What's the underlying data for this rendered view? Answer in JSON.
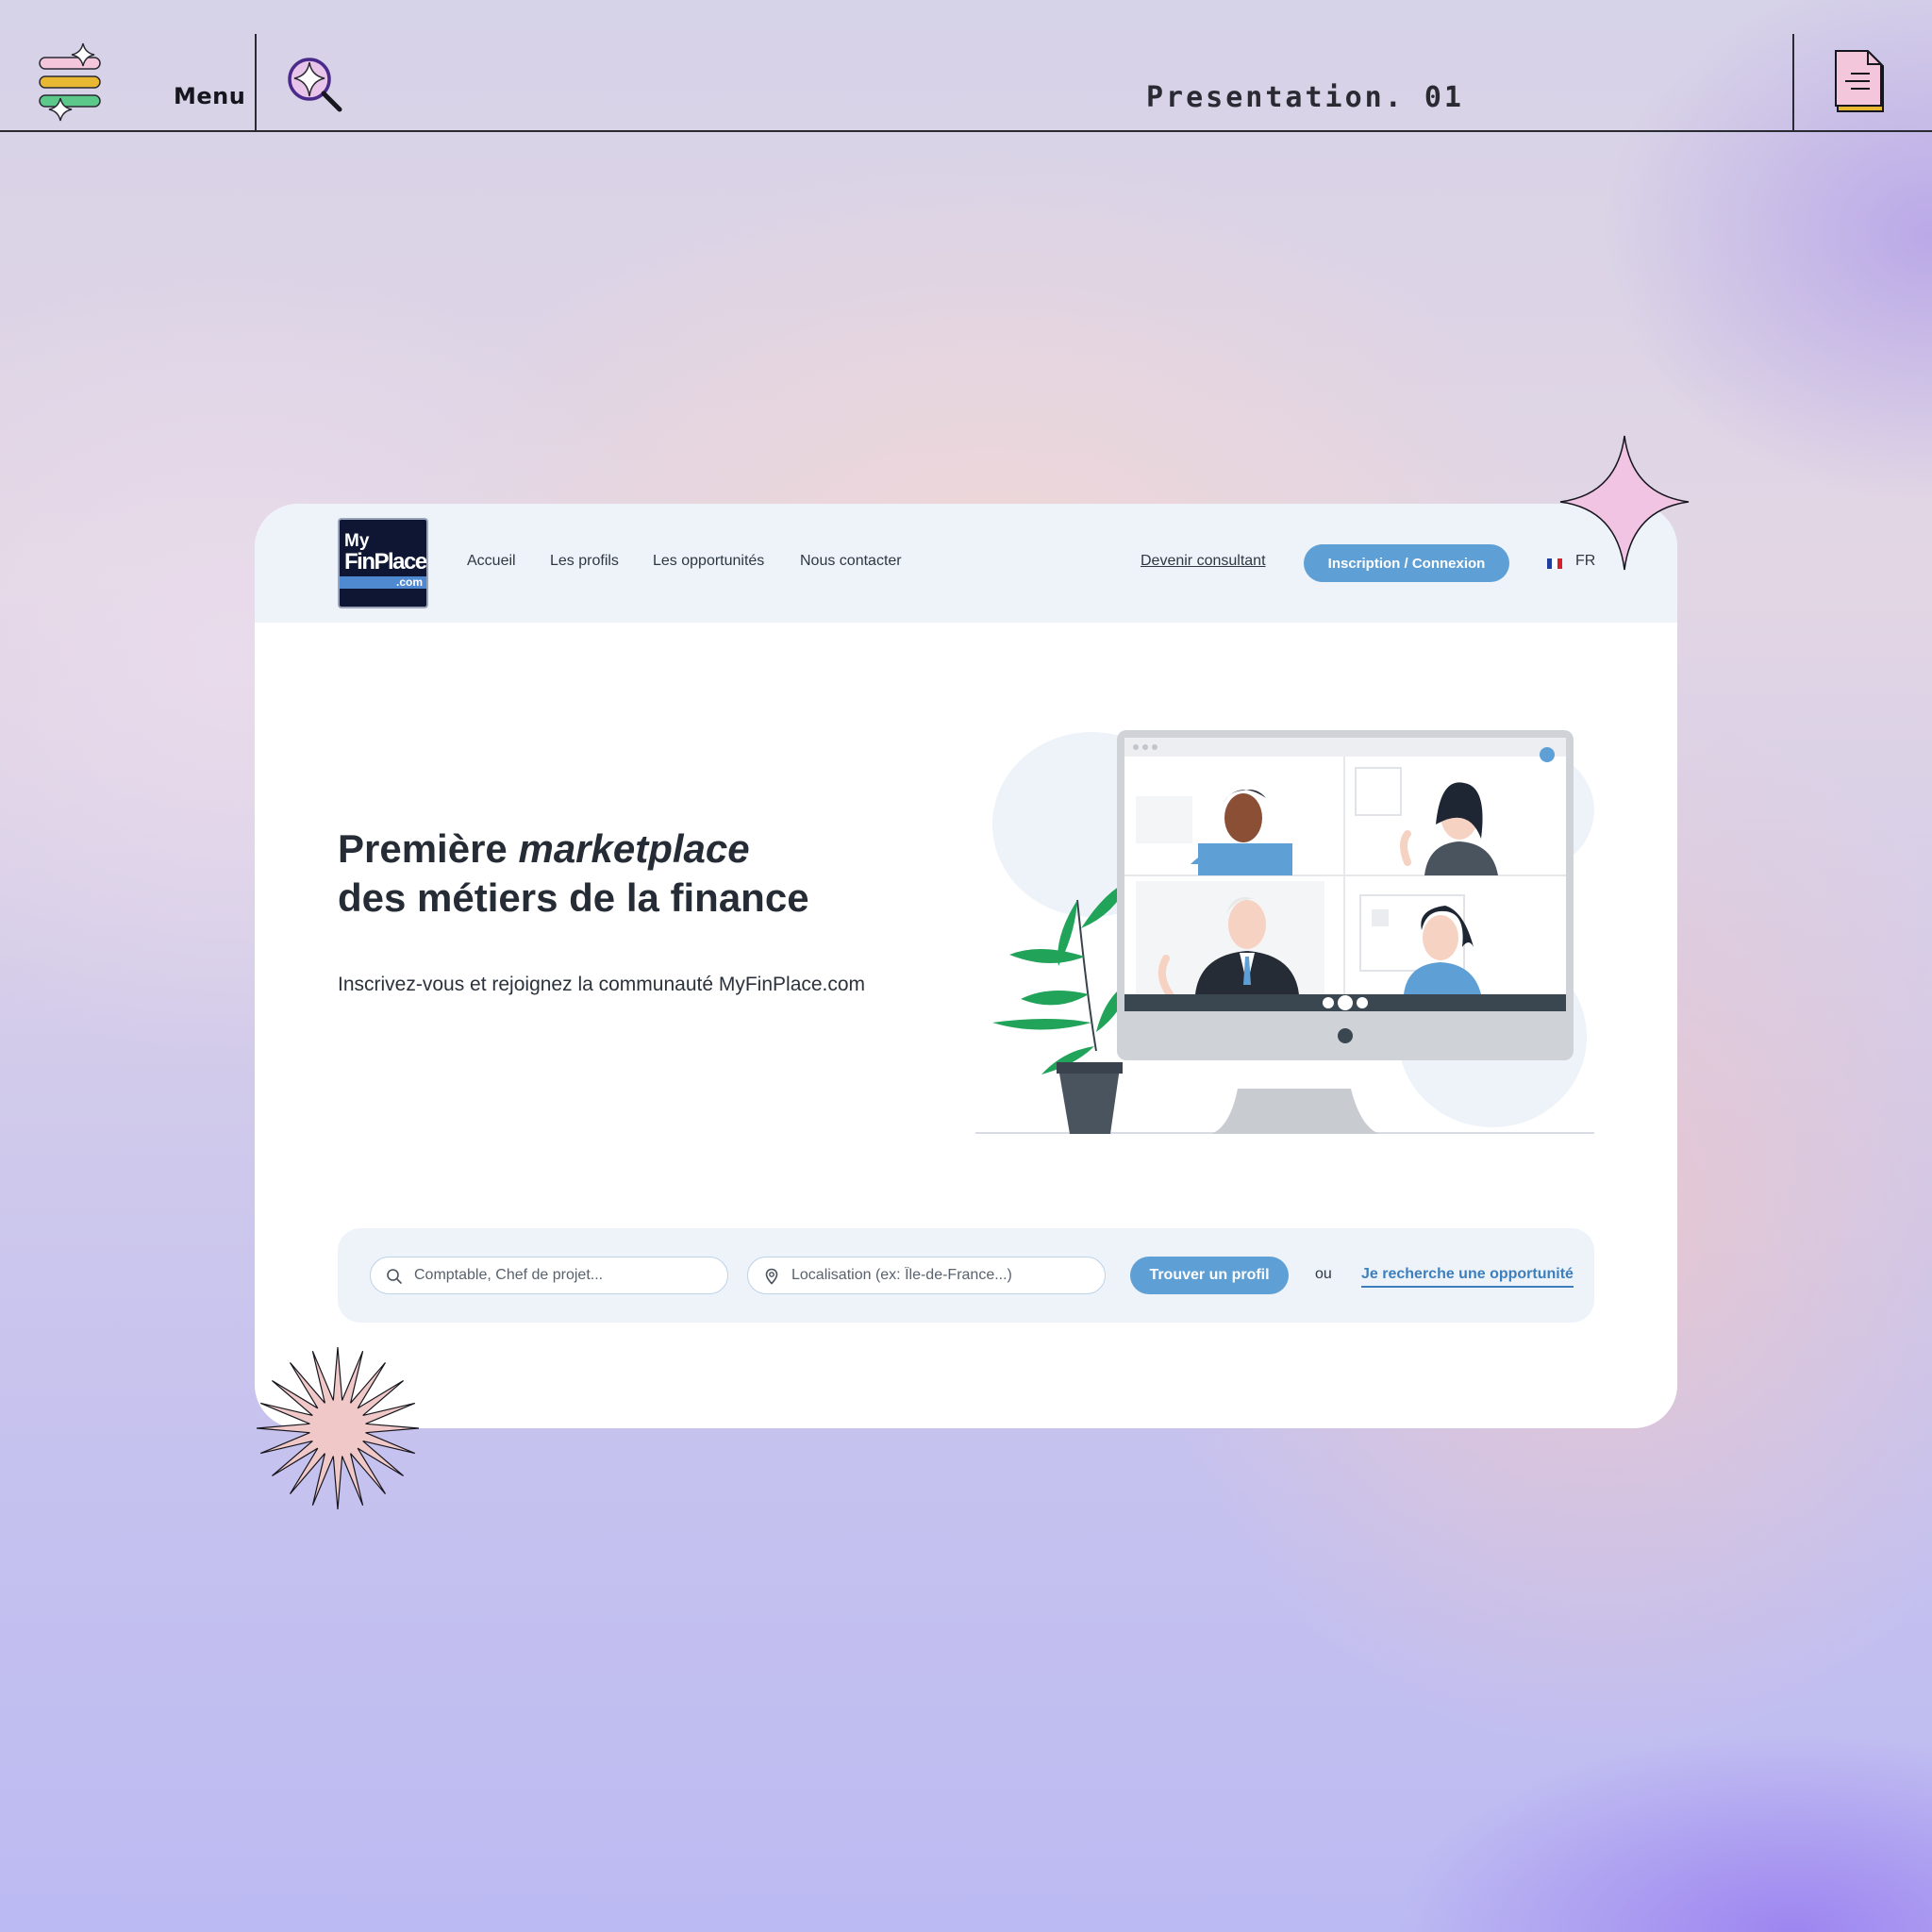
{
  "topbar": {
    "menu_label": "Menu",
    "presentation_title": "Presentation. 01"
  },
  "site": {
    "logo": {
      "line1": "My",
      "line2": "FinPlace",
      "line3": ".com"
    },
    "nav": [
      "Accueil",
      "Les profils",
      "Les opportunités",
      "Nous contacter"
    ],
    "consultant_link": "Devenir consultant",
    "login_button": "Inscription / Connexion",
    "language": "FR"
  },
  "hero": {
    "title_part1": "Première ",
    "title_em": "marketplace",
    "title_line2": "des métiers de la finance",
    "subtitle": "Inscrivez-vous et rejoignez la communauté MyFinPlace.com"
  },
  "search": {
    "job_placeholder": "Comptable, Chef de projet...",
    "location_placeholder": "Localisation (ex: Île-de-France...)",
    "find_button": "Trouver un profil",
    "or_label": "ou",
    "opportunity_link": "Je recherche une opportunité"
  },
  "colors": {
    "accent": "#5ea0d6",
    "link": "#3d7fbd",
    "nav_bg": "#eef3fa",
    "logo_bg": "#0e1633"
  }
}
